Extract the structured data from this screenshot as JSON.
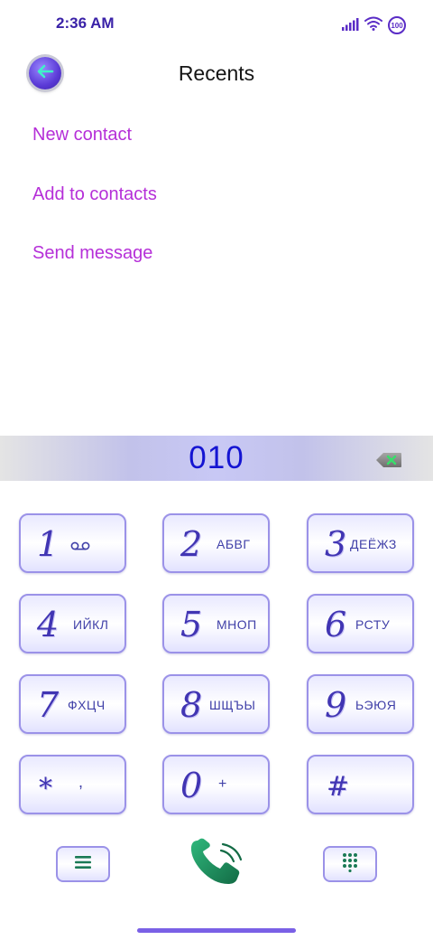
{
  "status": {
    "time": "2:36 AM",
    "battery": "100",
    "icons": [
      "signal-icon",
      "wifi-icon",
      "battery-icon"
    ]
  },
  "header": {
    "title": "Recents",
    "back_icon": "arrow-left-icon"
  },
  "actions": [
    {
      "label": "New contact"
    },
    {
      "label": "Add to contacts"
    },
    {
      "label": "Send message"
    }
  ],
  "dialer": {
    "number": "010",
    "backspace_icon": "backspace-icon"
  },
  "keypad": [
    {
      "digit": "1",
      "letters": ""
    },
    {
      "digit": "2",
      "letters": "АБВГ"
    },
    {
      "digit": "3",
      "letters": "ДЕЁЖЗ"
    },
    {
      "digit": "4",
      "letters": "ИЙКЛ"
    },
    {
      "digit": "5",
      "letters": "МНОП"
    },
    {
      "digit": "6",
      "letters": "РСТУ"
    },
    {
      "digit": "7",
      "letters": "ФХЦЧ"
    },
    {
      "digit": "8",
      "letters": "ШЩЪЫ"
    },
    {
      "digit": "9",
      "letters": "ЬЭЮЯ"
    },
    {
      "digit": "*",
      "letters": ","
    },
    {
      "digit": "0",
      "letters": "+"
    },
    {
      "digit": "#",
      "letters": ""
    }
  ],
  "bottom": {
    "menu_icon": "menu-icon",
    "call_icon": "phone-icon",
    "keypad_icon": "dialpad-icon"
  },
  "colors": {
    "accent": "#b52fd8",
    "number": "#1414d2",
    "key_border": "#9b92e8",
    "call": "#1f8a5a"
  }
}
